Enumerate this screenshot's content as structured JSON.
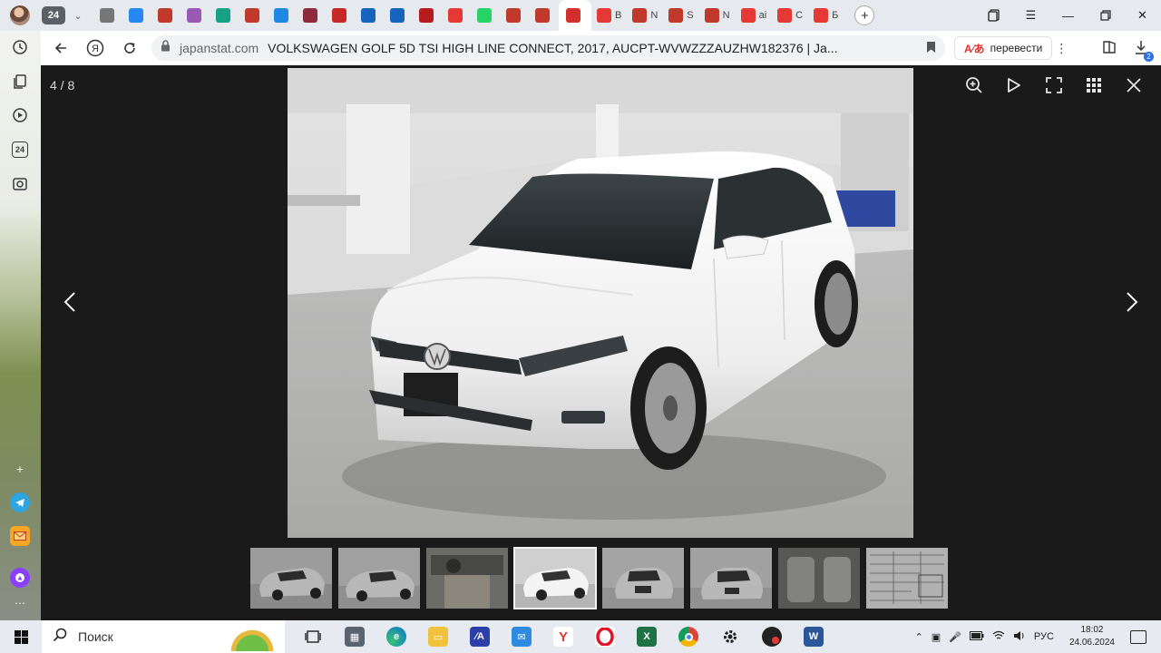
{
  "browser": {
    "tab_count": "24",
    "tabs": [
      {
        "label": "",
        "icon": "doc",
        "color": "#777777"
      },
      {
        "label": "",
        "icon": "vk",
        "color": "#2787f5"
      },
      {
        "label": "",
        "icon": "car",
        "color": "#c0392b"
      },
      {
        "label": "",
        "icon": "people",
        "color": "#9b59b6"
      },
      {
        "label": "",
        "icon": "dots",
        "color": "#16a085"
      },
      {
        "label": "",
        "icon": "car",
        "color": "#c0392b"
      },
      {
        "label": "",
        "icon": "2gis",
        "color": "#1e88e5"
      },
      {
        "label": "",
        "icon": "w",
        "color": "#8e2b3a"
      },
      {
        "label": "",
        "icon": "t",
        "color": "#c62828"
      },
      {
        "label": "",
        "icon": "circle",
        "color": "#1565c0"
      },
      {
        "label": "",
        "icon": "wave",
        "color": "#1565c0"
      },
      {
        "label": "",
        "icon": "pin",
        "color": "#b71c1c"
      },
      {
        "label": "",
        "icon": "youtube",
        "color": "#e53935"
      },
      {
        "label": "",
        "icon": "whatsapp",
        "color": "#25d366"
      },
      {
        "label": "",
        "icon": "car",
        "color": "#c0392b"
      },
      {
        "label": "",
        "icon": "car",
        "color": "#c0392b"
      },
      {
        "label": "",
        "icon": "active",
        "color": "#d32f2f",
        "active": true
      },
      {
        "label": "B",
        "icon": "pdf",
        "color": "#e53935"
      },
      {
        "label": "N",
        "icon": "car",
        "color": "#c0392b"
      },
      {
        "label": "S",
        "icon": "car",
        "color": "#c0392b"
      },
      {
        "label": "N",
        "icon": "car",
        "color": "#c0392b"
      },
      {
        "label": "ai",
        "icon": "yandex",
        "color": "#e53935"
      },
      {
        "label": "C",
        "icon": "heart",
        "color": "#e53935"
      },
      {
        "label": "Б",
        "icon": "heart",
        "color": "#e53935"
      }
    ],
    "domain": "japanstat.com",
    "page_title": "VOLKSWAGEN GOLF 5D TSI HIGH LINE CONNECT, 2017, AUCPT-WVWZZZAUZHW182376 | Ja...",
    "translate_label": "перевести",
    "downloads_badge": "2",
    "sidebar_badge": "24"
  },
  "viewer": {
    "counter": "4 / 8",
    "current_index": 4,
    "total": 8,
    "thumbnails": [
      {
        "kind": "car-front"
      },
      {
        "kind": "car-front-2"
      },
      {
        "kind": "interior"
      },
      {
        "kind": "car-front",
        "active": true
      },
      {
        "kind": "car-rear"
      },
      {
        "kind": "car-rear-2"
      },
      {
        "kind": "seats"
      },
      {
        "kind": "auction-sheet"
      }
    ]
  },
  "taskbar": {
    "search_placeholder": "Поиск",
    "language": "РУС",
    "time": "18:02",
    "date": "24.06.2024"
  },
  "colors": {
    "viewer_bg": "#1a1a1a",
    "accent_red": "#e53935",
    "taskbar_bg": "#e7eaf0"
  }
}
